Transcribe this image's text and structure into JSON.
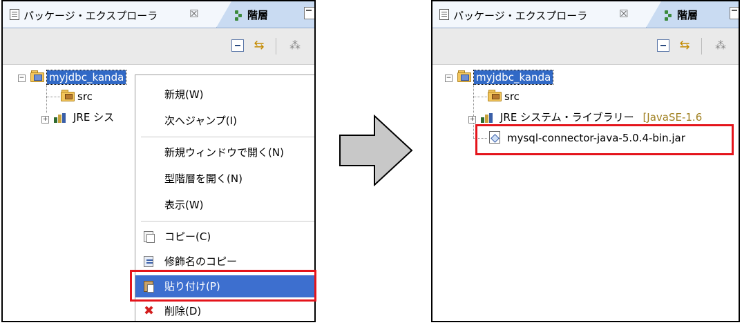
{
  "left": {
    "tab_title": "パッケージ・エクスプローラ",
    "tab_close": "☒",
    "hierarchy_tab": "階層",
    "tree": {
      "project": "myjdbc_kanda",
      "src": "src",
      "jre": "JRE シス"
    },
    "context_menu": {
      "items": [
        "新規(W)",
        "次へジャンプ(I)",
        "新規ウィンドウで開く(N)",
        "型階層を開く(N)",
        "表示(W)",
        "コピー(C)",
        "修飾名のコピー",
        "貼り付け(P)",
        "削除(D)"
      ],
      "active_index": 7
    }
  },
  "right": {
    "tab_title": "パッケージ・エクスプローラ",
    "tab_close": "☒",
    "hierarchy_tab": "階層",
    "tree": {
      "project": "myjdbc_kanda",
      "src": "src",
      "jre": "JRE システム・ライブラリー",
      "jre_type": "[JavaSE-1.6",
      "jar": "mysql-connector-java-5.0.4-bin.jar"
    }
  },
  "colors": {
    "highlight": "#e4141b",
    "selection": "#3169c6",
    "arrow_fill": "#c8c8c8"
  }
}
